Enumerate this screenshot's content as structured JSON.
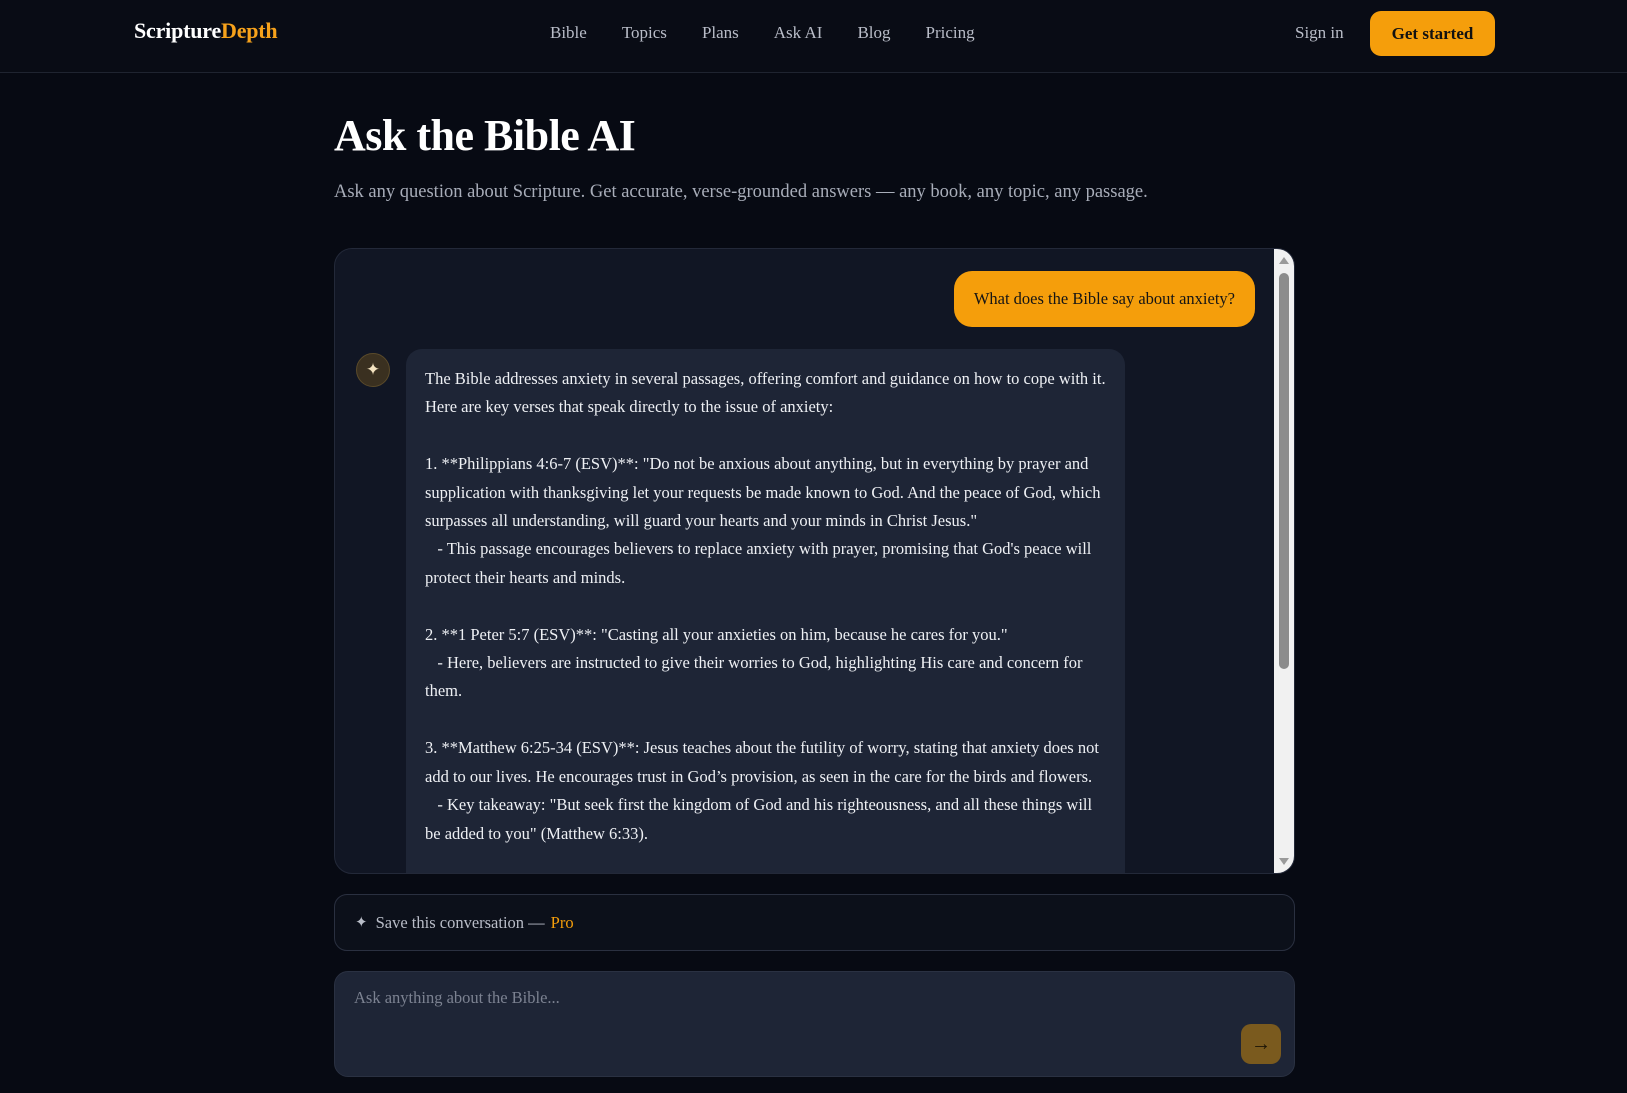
{
  "header": {
    "brand_part1": "Scripture",
    "brand_part2": "Depth",
    "nav": [
      "Bible",
      "Topics",
      "Plans",
      "Ask AI",
      "Blog",
      "Pricing"
    ],
    "signin_label": "Sign in",
    "cta_label": "Get started"
  },
  "hero": {
    "title": "Ask the Bible AI",
    "subtitle": "Ask any question about Scripture. Get accurate, verse-grounded answers — any book, any topic, any passage."
  },
  "chat": {
    "user_message": "What does the Bible say about anxiety?",
    "ai_avatar_icon": "sparkle-icon",
    "ai_message": "The Bible addresses anxiety in several passages, offering comfort and guidance on how to cope with it. Here are key verses that speak directly to the issue of anxiety:\n\n1. **Philippians 4:6-7 (ESV)**: \"Do not be anxious about anything, but in everything by prayer and supplication with thanksgiving let your requests be made known to God. And the peace of God, which surpasses all understanding, will guard your hearts and your minds in Christ Jesus.\"\n   - This passage encourages believers to replace anxiety with prayer, promising that God's peace will protect their hearts and minds.\n\n2. **1 Peter 5:7 (ESV)**: \"Casting all your anxieties on him, because he cares for you.\"\n   - Here, believers are instructed to give their worries to God, highlighting His care and concern for them.\n\n3. **Matthew 6:25-34 (ESV)**: Jesus teaches about the futility of worry, stating that anxiety does not add to our lives. He encourages trust in God’s provision, as seen in the care for the birds and flowers.\n   - Key takeaway: \"But seek first the kingdom of God and his righteousness, and all these things will be added to you\" (Matthew 6:33)."
  },
  "save_bar": {
    "icon": "sparkle-icon",
    "label": "Save this conversation —",
    "pro_label": "Pro"
  },
  "input": {
    "placeholder": "Ask anything about the Bible...",
    "value": "",
    "send_icon": "arrow-right-icon"
  },
  "colors": {
    "accent": "#f59e0b",
    "background": "#070a13",
    "panel": "#111624",
    "bubble": "#1e2536"
  }
}
